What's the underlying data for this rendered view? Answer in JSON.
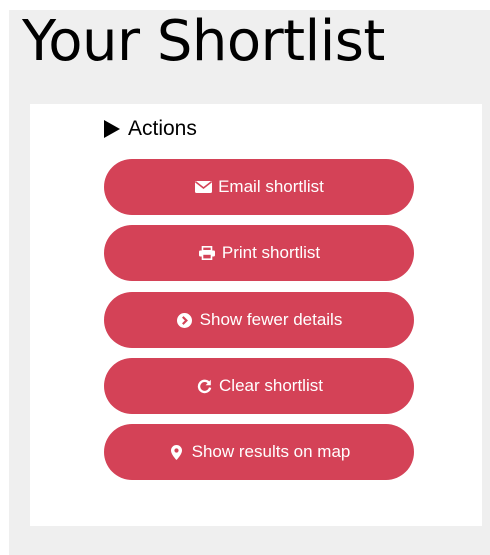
{
  "header": {
    "title": "Your Shortlist"
  },
  "actions": {
    "toggle_label": "Actions",
    "buttons": [
      {
        "label": "Email shortlist",
        "icon": "envelope-icon"
      },
      {
        "label": "Print shortlist",
        "icon": "printer-icon"
      },
      {
        "label": "Show fewer details",
        "icon": "chevron-circle-icon"
      },
      {
        "label": "Clear shortlist",
        "icon": "refresh-icon"
      },
      {
        "label": "Show results on map",
        "icon": "map-marker-icon"
      }
    ]
  },
  "colors": {
    "button_bg": "#d44257",
    "panel_bg": "#efefef"
  }
}
